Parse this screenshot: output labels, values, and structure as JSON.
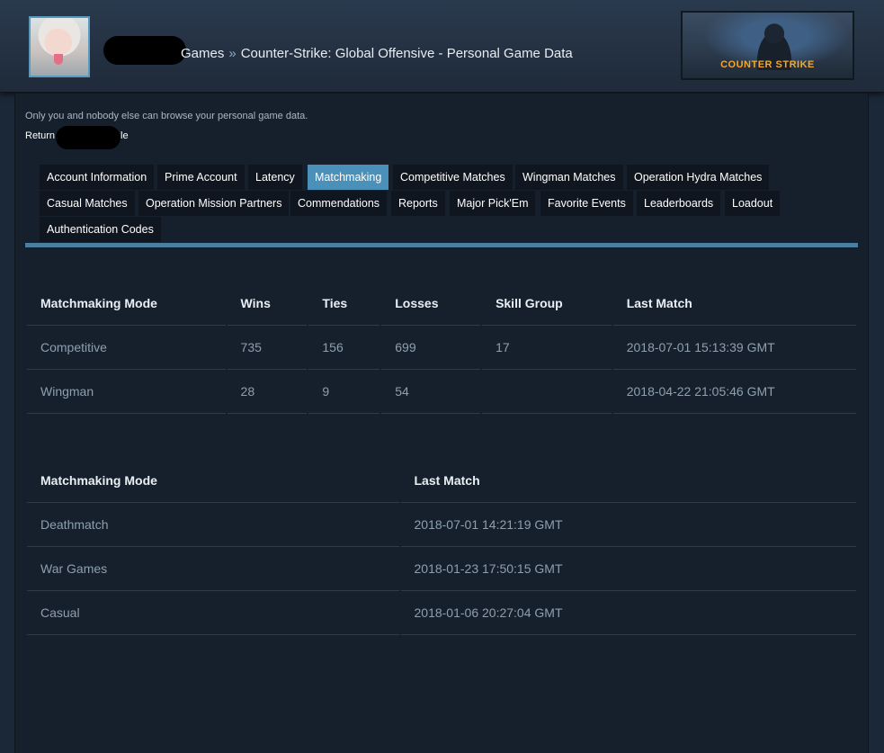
{
  "header": {
    "breadcrumb": {
      "games": "Games",
      "separator": "»",
      "page": "Counter-Strike: Global Offensive - Personal Game Data"
    },
    "banner_text": "COUNTER STRIKE"
  },
  "notice": "Only you and nobody else can browse your personal game data.",
  "return_link": {
    "prefix": "Return",
    "suffix": "le"
  },
  "tabs": [
    "Account Information",
    "Prime Account",
    "Latency",
    "Matchmaking",
    "Competitive Matches",
    "Wingman Matches",
    "Operation Hydra Matches",
    "Casual Matches",
    "Operation Mission Partners",
    "Commendations",
    "Reports",
    "Major Pick'Em",
    "Favorite Events",
    "Leaderboards",
    "Loadout",
    "Authentication Codes"
  ],
  "active_tab": "Matchmaking",
  "table1": {
    "headers": [
      "Matchmaking Mode",
      "Wins",
      "Ties",
      "Losses",
      "Skill Group",
      "Last Match"
    ],
    "rows": [
      [
        "Competitive",
        "735",
        "156",
        "699",
        "17",
        "2018-07-01 15:13:39 GMT"
      ],
      [
        "Wingman",
        "28",
        "9",
        "54",
        "",
        "2018-04-22 21:05:46 GMT"
      ]
    ]
  },
  "table2": {
    "headers": [
      "Matchmaking Mode",
      "Last Match"
    ],
    "rows": [
      [
        "Deathmatch",
        "2018-07-01 14:21:19 GMT"
      ],
      [
        "War Games",
        "2018-01-23 17:50:15 GMT"
      ],
      [
        "Casual",
        "2018-01-06 20:27:04 GMT"
      ]
    ]
  },
  "colors": {
    "background": "#1b2838",
    "active_tab": "#4b90b8",
    "tab": "#0f161f",
    "banner_accent": "#f3a72d"
  }
}
